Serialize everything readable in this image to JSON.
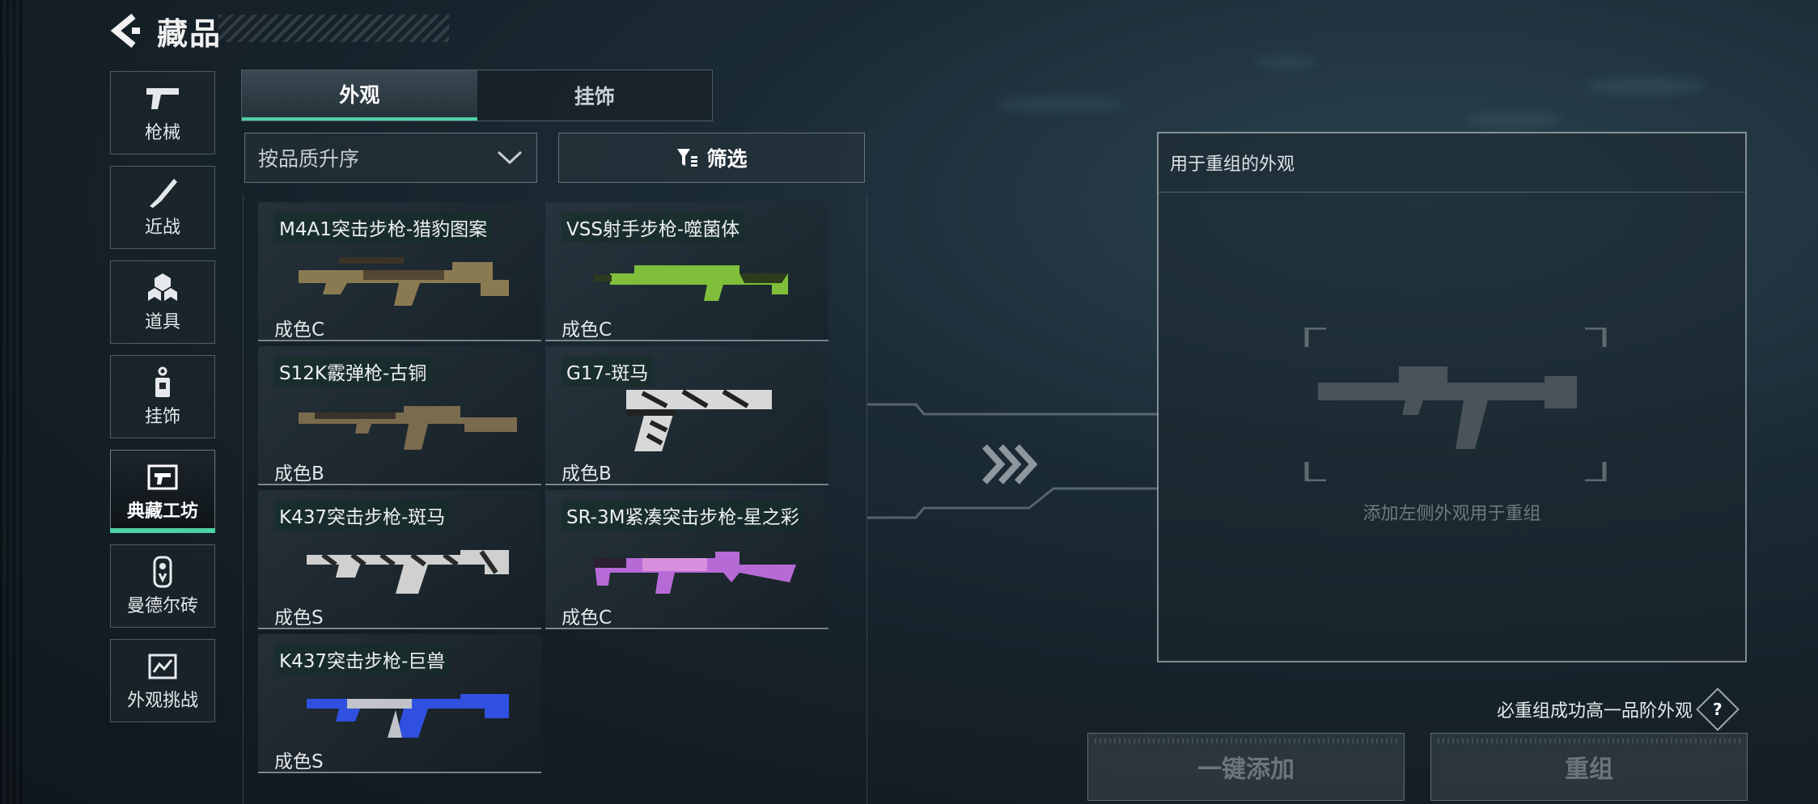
{
  "header": {
    "title": "藏品"
  },
  "categories": [
    {
      "label": "枪械",
      "icon": "pistol-icon",
      "active": false
    },
    {
      "label": "近战",
      "icon": "knife-icon",
      "active": false
    },
    {
      "label": "道具",
      "icon": "cubes-icon",
      "active": false
    },
    {
      "label": "挂饰",
      "icon": "charm-icon",
      "active": false
    },
    {
      "label": "典藏工坊",
      "icon": "workshop-icon",
      "active": true
    },
    {
      "label": "曼德尔砖",
      "icon": "brick-icon",
      "active": false
    },
    {
      "label": "外观挑战",
      "icon": "challenge-icon",
      "active": false
    }
  ],
  "tabs": [
    {
      "label": "外观",
      "active": true
    },
    {
      "label": "挂饰",
      "active": false
    }
  ],
  "sort": {
    "value": "按品质升序"
  },
  "filter": {
    "label": "筛选"
  },
  "items": [
    {
      "name": "M4A1突击步枪-猎豹图案",
      "grade": "成色C",
      "color": "#8a7a52",
      "accent": "#3a3226"
    },
    {
      "name": "VSS射手步枪-噬菌体",
      "grade": "成色C",
      "color": "#7fbf3a",
      "accent": "#2d3b1c"
    },
    {
      "name": "S12K霰弹枪-古铜",
      "grade": "成色B",
      "color": "#7a6a4e",
      "accent": "#3a332a"
    },
    {
      "name": "G17-斑马",
      "grade": "成色B",
      "color": "#d8d8d8",
      "accent": "#222222"
    },
    {
      "name": "K437突击步枪-斑马",
      "grade": "成色S",
      "color": "#d0d0d0",
      "accent": "#2a2a2a"
    },
    {
      "name": "SR-3M紧凑突击步枪-星之彩",
      "grade": "成色C",
      "color": "#b66ad6",
      "accent": "#2a2030"
    },
    {
      "name": "K437突击步枪-巨兽",
      "grade": "成色S",
      "color": "#3050e0",
      "accent": "#c0c4c8"
    }
  ],
  "recompose": {
    "title": "用于重组的外观",
    "hint": "添加左侧外观用于重组"
  },
  "guarantee": {
    "text": "必重组成功高一品阶外观",
    "help": "?"
  },
  "buttons": {
    "add_all": "一键添加",
    "recompose": "重组"
  }
}
